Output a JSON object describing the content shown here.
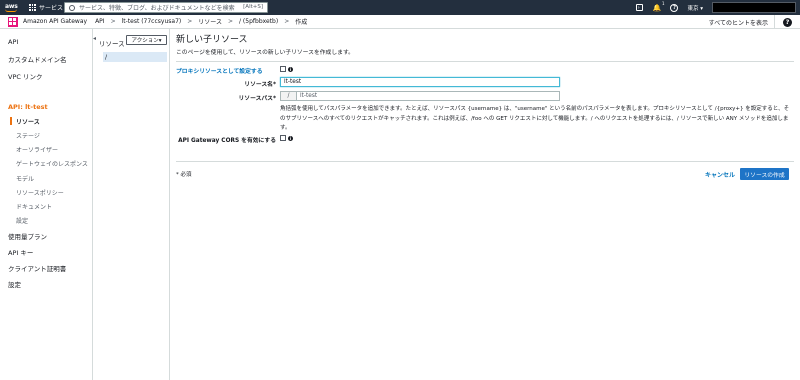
{
  "topbar": {
    "logo_text": "aws",
    "services_label": "サービス",
    "search_placeholder": "サービス、特徴、ブログ、およびドキュメントなどを検索",
    "search_shortcut": "[Alt+S]",
    "notification_count": "1",
    "region_label": "東京 ▾"
  },
  "subbar": {
    "service_name": "Amazon API Gateway",
    "breadcrumbs": [
      "API",
      "lt-test (77ccsyusa7)",
      "リソース",
      "/ (5pfbbxetb)",
      "作成"
    ],
    "hints_label": "すべてのヒントを表示"
  },
  "leftnav": {
    "items": [
      {
        "label": "API"
      },
      {
        "label": "カスタムドメイン名"
      },
      {
        "label": "VPC リンク"
      },
      {
        "label": "API: lt-test"
      },
      {
        "label": "リソース"
      },
      {
        "label": "ステージ"
      },
      {
        "label": "オーソライザー"
      },
      {
        "label": "ゲートウェイのレスポンス"
      },
      {
        "label": "モデル"
      },
      {
        "label": "リソースポリシー"
      },
      {
        "label": "ドキュメント"
      },
      {
        "label": "設定"
      },
      {
        "label": "使用量プラン"
      },
      {
        "label": "API キー"
      },
      {
        "label": "クライアント証明書"
      },
      {
        "label": "設定"
      }
    ]
  },
  "resources": {
    "title": "リソース",
    "actions_label": "アクション▾",
    "tree_root": "/"
  },
  "main": {
    "title": "新しい子リソース",
    "description": "このページを使用して、リソースの新しい子リソースを作成します。",
    "proxy_label": "プロキシリソースとして設定する",
    "name_label": "リソース名*",
    "name_value": "lt-test",
    "path_label": "リソースパス*",
    "path_prefix": "/",
    "path_value": "lt-test",
    "path_help": "角括弧を使用してパスパラメータを追加できます。たとえば、リソースパス {username} は、\"username\" という名前のパスパラメータを表します。プロキシリソースとして /{proxy+} を設定すると、そのサブリソースへのすべてのリクエストがキャッチされます。これは例えば、/foo への GET リクエストに対して機能します。/ へのリクエストを処理するには、/ リソースで新しい ANY メソッドを追加します。",
    "cors_label": "API Gateway CORS を有効にする",
    "required_note": "* 必須",
    "cancel_label": "キャンセル",
    "create_label": "リソースの作成"
  },
  "colors": {
    "topbar_bg": "#232f3e",
    "accent_orange": "#ec7211",
    "link_blue": "#0073bb",
    "primary_button": "#1e74c7",
    "selected_row": "#dbe9f6"
  }
}
